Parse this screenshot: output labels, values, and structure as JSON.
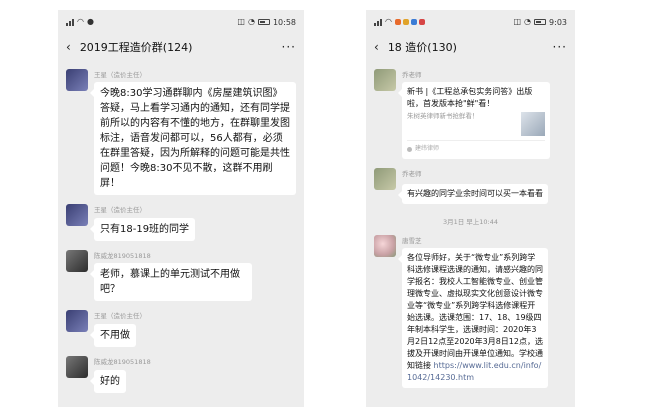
{
  "left": {
    "status": {
      "time": "10:58"
    },
    "title": "2019工程造价群(124)",
    "messages": [
      {
        "sender": "王星（造价主任）",
        "text": "今晚8:30学习通群聊内《房屋建筑识图》答疑，马上看学习通内的通知，还有同学提前所以的内容有不懂的地方，在群聊里发图标注，语音发问都可以，56人都有，必须在群里答疑，因为所解释的问题可能是共性问题！今晚8:30不见不散，这群不用刷屏！"
      },
      {
        "sender": "王星（造价主任）",
        "text": "只有18-19班的同学"
      },
      {
        "sender": "陈威龙819051818",
        "text": "老师，慕课上的单元测试不用做吧？"
      },
      {
        "sender": "王星（造价主任）",
        "text": "不用做"
      },
      {
        "sender": "陈威龙819051818",
        "text": "好的"
      }
    ]
  },
  "right": {
    "status": {
      "time": "9:03"
    },
    "title": "18 造价(130)",
    "card": {
      "sender": "乔老师",
      "title": "新书 |《工程总承包实务问答》出版啦，首发版本抢\"鲜\"看！",
      "subtitle": "朱树英律师新书抢鲜看！",
      "source": "建纬律师"
    },
    "msg2": {
      "sender": "乔老师",
      "text": "有兴趣的同学业余时间可以买一本看看"
    },
    "timestamp": "3月1日 早上10:44",
    "msg3": {
      "sender": "唐雪芝",
      "text": "各位导师好，关于“微专业”系列跨学科选修课程选课的通知，请感兴趣的同学报名：我校人工智能微专业、创业管理微专业、虚拟现实文化创意设计微专业等“微专业”系列跨学科选修课程开始选课。选课范围：17、18、19级四年制本科学生，选课时间：2020年3月2日12点至2020年3月8日12点，选拔及开课时间由开课单位通知。学校通知链接",
      "link": "https://www.lit.edu.cn/info/1042/14230.htm"
    }
  },
  "icons": {
    "back": "‹",
    "more": "···"
  },
  "colors": {
    "chat_bg": "#ededed",
    "bubble": "#ffffff",
    "link": "#576b95",
    "sender": "#999999"
  }
}
